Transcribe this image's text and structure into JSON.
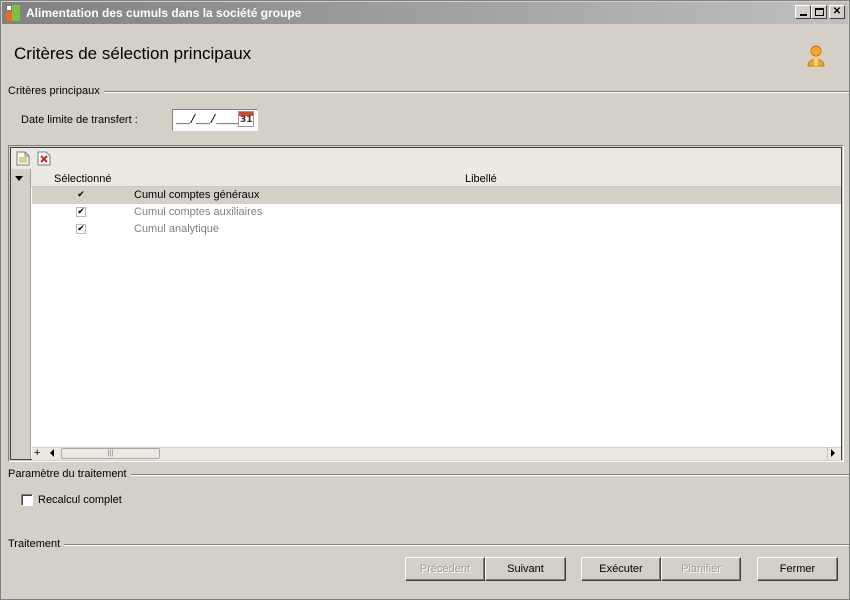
{
  "window": {
    "title": "Alimentation des cumuls dans la société groupe"
  },
  "page": {
    "title": "Critères de sélection principaux"
  },
  "criteria_group": {
    "label": "Critères principaux",
    "date_label": "Date limite de transfert :",
    "date_value": "__/__/____",
    "calendar_day": "31"
  },
  "grid": {
    "columns": [
      "Sélectionné",
      "Libellé"
    ],
    "rows": [
      {
        "selected": "✔",
        "label": "Cumul comptes généraux"
      },
      {
        "selected": "✔",
        "label": "Cumul comptes auxiliaires"
      },
      {
        "selected": "✔",
        "label": "Cumul analytique"
      }
    ],
    "add_symbol": "+",
    "thumb_grip": "|||"
  },
  "parameters_group": {
    "label": "Paramètre du traitement",
    "recalc_label": "Recalcul complet",
    "recalc_checked": false
  },
  "processing_group": {
    "label": "Traitement"
  },
  "buttons": {
    "previous": "Précédent",
    "next": "Suivant",
    "execute": "Exécuter",
    "schedule": "Planifier",
    "close": "Fermer"
  },
  "colors": {
    "background": "#d4d0c8",
    "titlebar": "#808080",
    "selected_row": "#d4d0c8",
    "disabled_text": "#9a9a9a",
    "user_icon": "#f5a623"
  }
}
